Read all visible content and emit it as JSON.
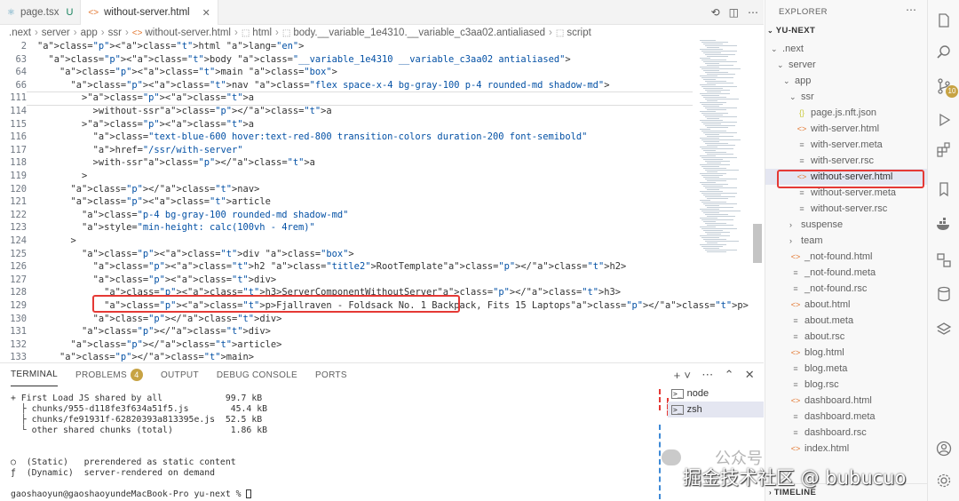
{
  "tabs": [
    {
      "label": "page.tsx",
      "status": "U",
      "icon": "react-icon"
    },
    {
      "label": "without-server.html",
      "icon": "html-icon"
    }
  ],
  "breadcrumb": [
    ".next",
    "server",
    "app",
    "ssr",
    "without-server.html",
    "html",
    "body.__variable_1e4310.__variable_c3aa02.antialiased",
    "script"
  ],
  "code_lines": [
    {
      "n": "2",
      "code": "<html lang=\"en\">"
    },
    {
      "n": "63",
      "code": "  <body class=\"__variable_1e4310 __variable_c3aa02 antialiased\">"
    },
    {
      "n": "64",
      "code": "    <main class=\"box\">"
    },
    {
      "n": "66",
      "code": "      <nav class=\"flex space-x-4 bg-gray-100 p-4 rounded-md shadow-md\">"
    },
    {
      "n": "111",
      "code": "        ><a"
    },
    {
      "n": "114",
      "code": "          >without-ssr</a"
    },
    {
      "n": "115",
      "code": "        ><a"
    },
    {
      "n": "116",
      "code": "          class=\"text-blue-600 hover:text-red-800 transition-colors duration-200 font-semibold\""
    },
    {
      "n": "117",
      "code": "          href=\"/ssr/with-server\""
    },
    {
      "n": "118",
      "code": "          >with-ssr</a"
    },
    {
      "n": "119",
      "code": "        >"
    },
    {
      "n": "120",
      "code": "      </nav>"
    },
    {
      "n": "121",
      "code": "      <article"
    },
    {
      "n": "122",
      "code": "        class=\"p-4 bg-gray-100 rounded-md shadow-md\""
    },
    {
      "n": "123",
      "code": "        style=\"min-height: calc(100vh - 4rem)\""
    },
    {
      "n": "124",
      "code": "      >"
    },
    {
      "n": "125",
      "code": "        <div class=\"box\">"
    },
    {
      "n": "126",
      "code": "          <h2 class=\"title2\">RootTemplate</h2>"
    },
    {
      "n": "127",
      "code": "          <div>"
    },
    {
      "n": "128",
      "code": "            <h3>ServerComponentWithoutServer</h3>"
    },
    {
      "n": "129",
      "code": "            <p>Fjallraven - Foldsack No. 1 Backpack, Fits 15 Laptops</p>"
    },
    {
      "n": "130",
      "code": "          </div>"
    },
    {
      "n": "131",
      "code": "        </div>"
    },
    {
      "n": "132",
      "code": "      </article>"
    },
    {
      "n": "133",
      "code": "    </main>"
    }
  ],
  "panel": {
    "tabs": [
      "TERMINAL",
      "PROBLEMS",
      "OUTPUT",
      "DEBUG CONSOLE",
      "PORTS"
    ],
    "problems_count": "4",
    "terminal_lines": [
      "+ First Load JS shared by all            99.7 kB",
      "  ├ chunks/955-d118fe3f634a51f5.js        45.4 kB",
      "  ├ chunks/fe91931f-62820393a813395e.js  52.5 kB",
      "  └ other shared chunks (total)           1.86 kB",
      "",
      "",
      "○  (Static)   prerendered as static content",
      "ƒ  (Dynamic)  server-rendered on demand",
      "",
      "gaoshaoyun@gaoshaoyundeMacBook-Pro yu-next % "
    ],
    "terminals": [
      "node",
      "zsh"
    ]
  },
  "explorer": {
    "title": "EXPLORER",
    "root": "YU-NEXT",
    "items": [
      {
        "label": ".next",
        "depth": 0,
        "type": "folder-open"
      },
      {
        "label": "server",
        "depth": 1,
        "type": "folder-open"
      },
      {
        "label": "app",
        "depth": 2,
        "type": "folder-open"
      },
      {
        "label": "ssr",
        "depth": 3,
        "type": "folder-open"
      },
      {
        "label": "page.js.nft.json",
        "depth": 4,
        "type": "json"
      },
      {
        "label": "with-server.html",
        "depth": 4,
        "type": "html"
      },
      {
        "label": "with-server.meta",
        "depth": 4,
        "type": "txt"
      },
      {
        "label": "with-server.rsc",
        "depth": 4,
        "type": "txt"
      },
      {
        "label": "without-server.html",
        "depth": 4,
        "type": "html",
        "selected": true
      },
      {
        "label": "without-server.meta",
        "depth": 4,
        "type": "txt"
      },
      {
        "label": "without-server.rsc",
        "depth": 4,
        "type": "txt"
      },
      {
        "label": "suspense",
        "depth": 3,
        "type": "folder"
      },
      {
        "label": "team",
        "depth": 3,
        "type": "folder"
      },
      {
        "label": "_not-found.html",
        "depth": 3,
        "type": "html"
      },
      {
        "label": "_not-found.meta",
        "depth": 3,
        "type": "txt"
      },
      {
        "label": "_not-found.rsc",
        "depth": 3,
        "type": "txt"
      },
      {
        "label": "about.html",
        "depth": 3,
        "type": "html"
      },
      {
        "label": "about.meta",
        "depth": 3,
        "type": "txt"
      },
      {
        "label": "about.rsc",
        "depth": 3,
        "type": "txt"
      },
      {
        "label": "blog.html",
        "depth": 3,
        "type": "html"
      },
      {
        "label": "blog.meta",
        "depth": 3,
        "type": "txt"
      },
      {
        "label": "blog.rsc",
        "depth": 3,
        "type": "txt"
      },
      {
        "label": "dashboard.html",
        "depth": 3,
        "type": "html"
      },
      {
        "label": "dashboard.meta",
        "depth": 3,
        "type": "txt"
      },
      {
        "label": "dashboard.rsc",
        "depth": 3,
        "type": "txt"
      },
      {
        "label": "index.html",
        "depth": 3,
        "type": "html"
      }
    ],
    "timeline": "TIMELINE"
  },
  "activity": {
    "scm_badge": "10"
  },
  "watermark": {
    "line1": "公众号",
    "line2": "掘金技术社区 @ bubucuo"
  },
  "colors": {
    "highlight_red": "#e53935",
    "html_icon": "#e37933",
    "badge": "#c7a344"
  }
}
